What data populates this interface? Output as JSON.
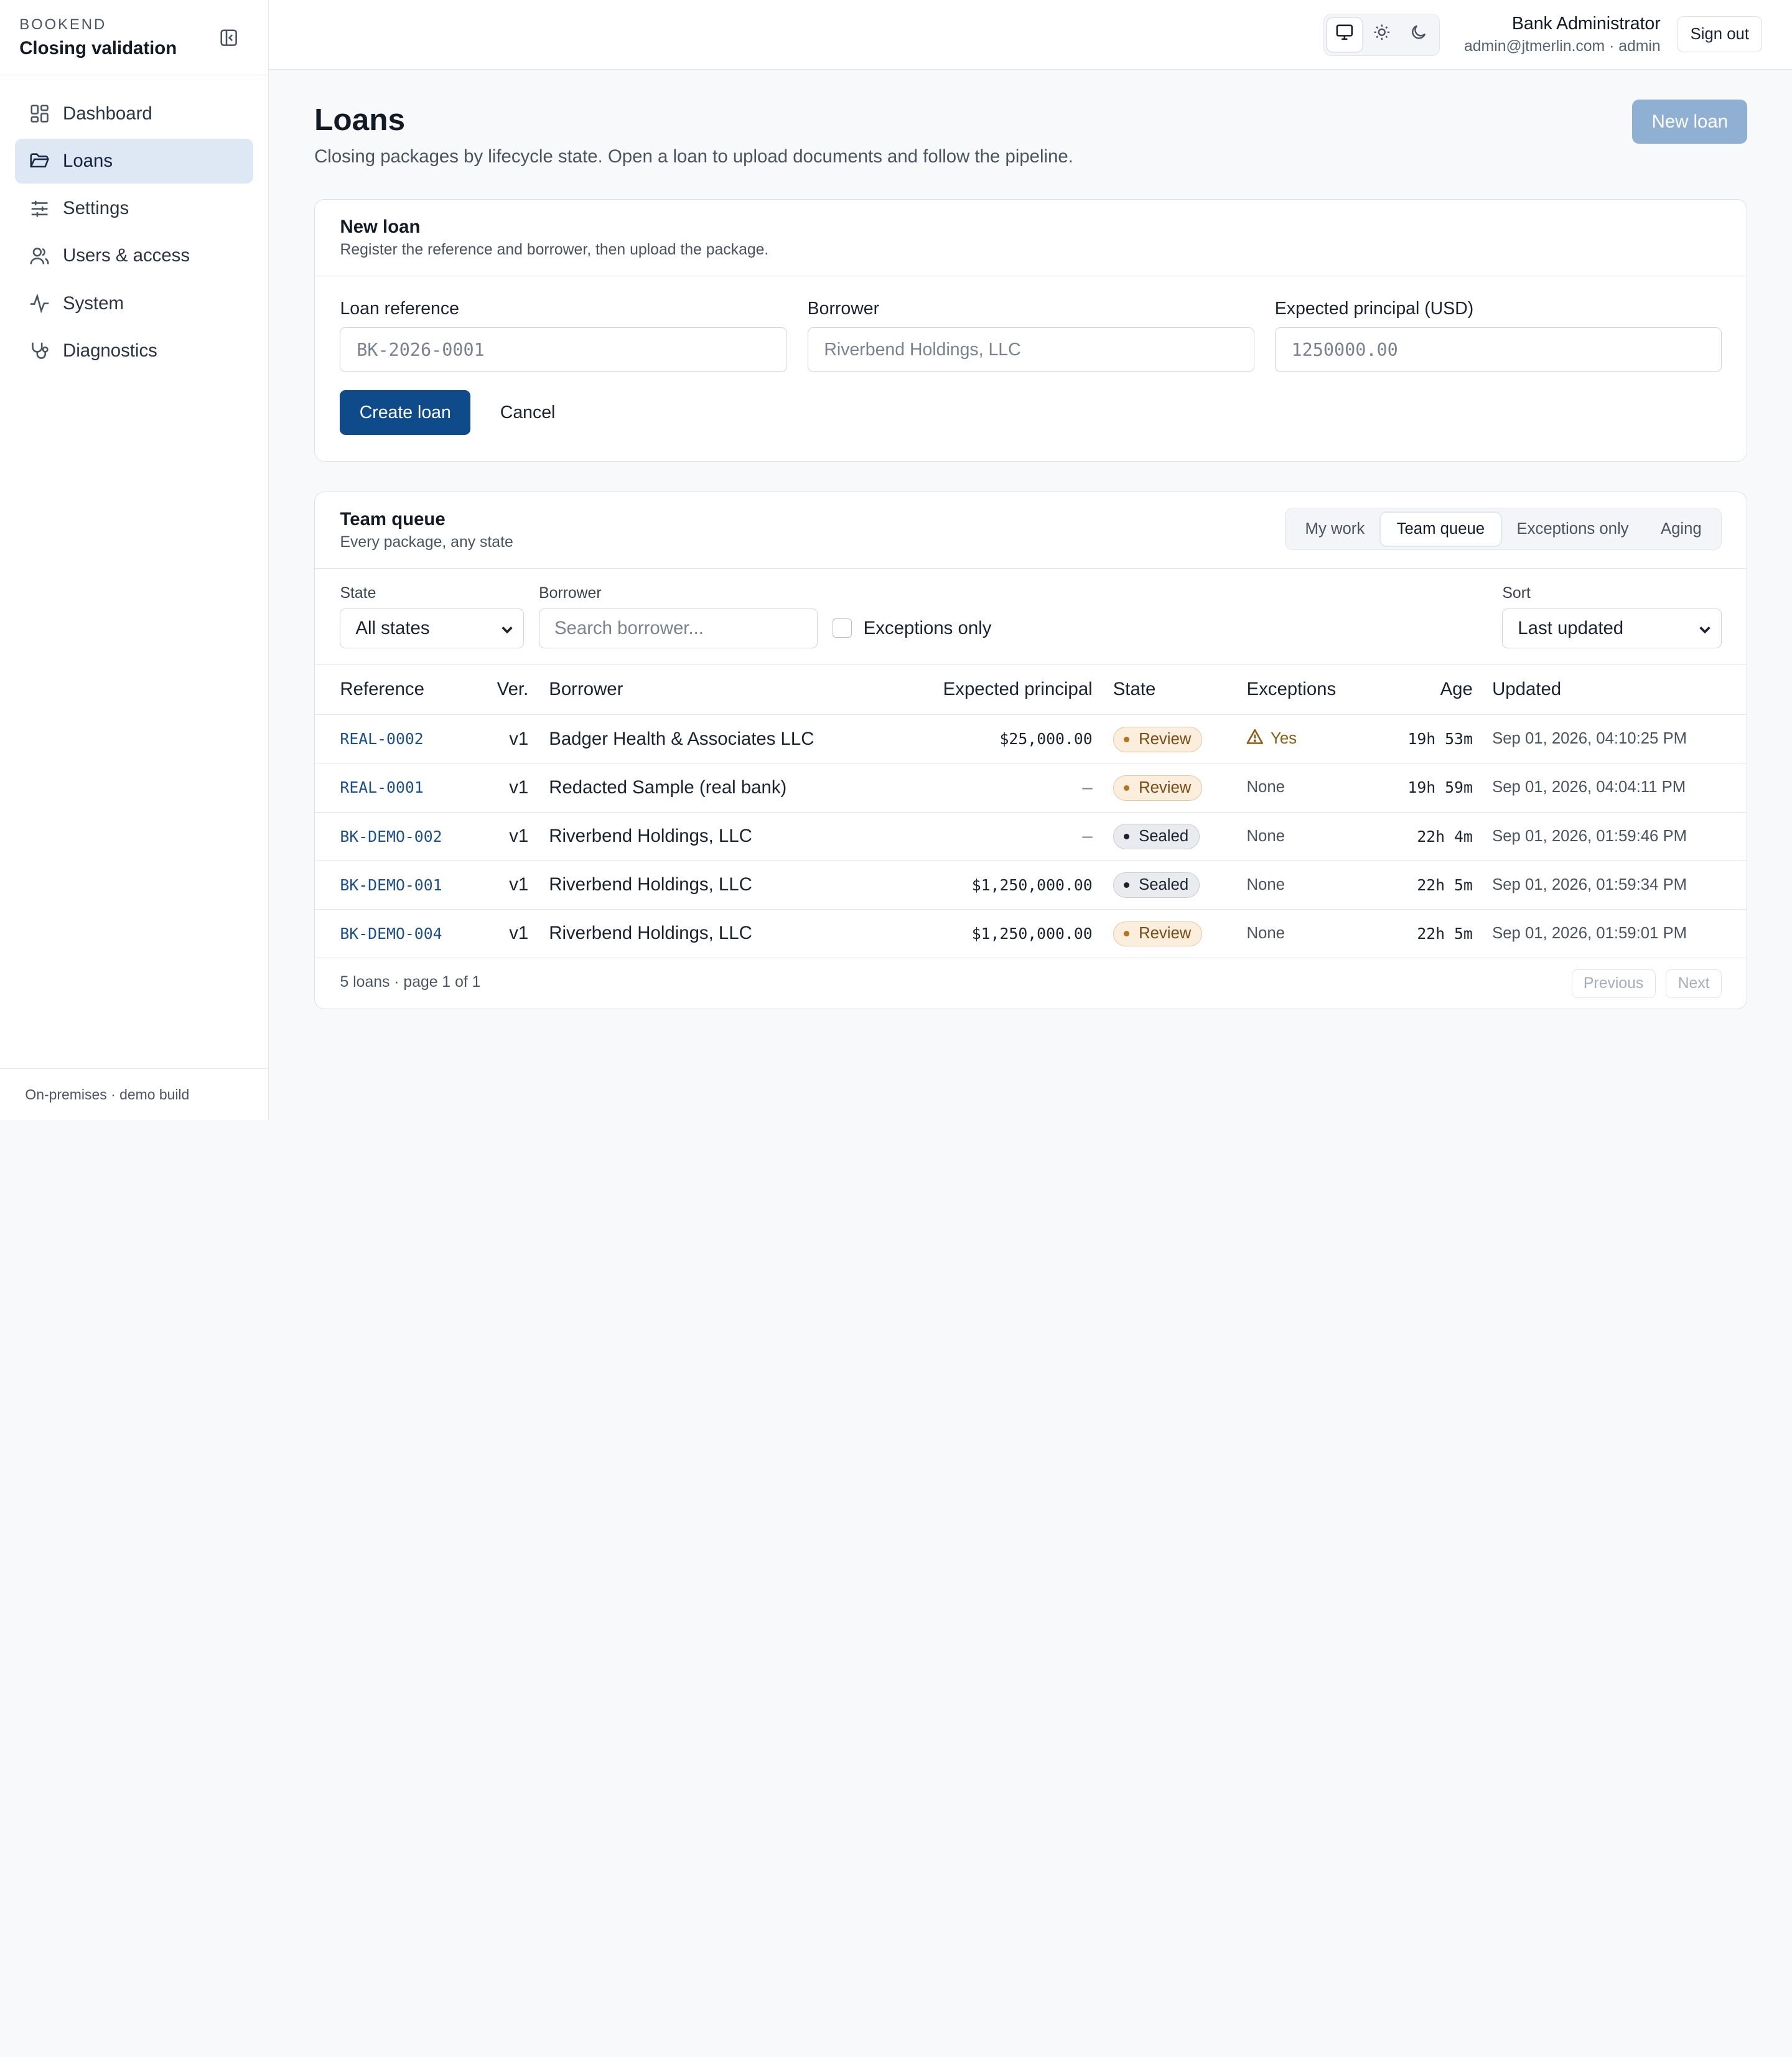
{
  "brand": {
    "eyebrow": "BOOKEND",
    "title": "Closing validation"
  },
  "sidebar": {
    "items": [
      {
        "label": "Dashboard",
        "icon": "dashboard-icon"
      },
      {
        "label": "Loans",
        "icon": "folder-icon",
        "active": true
      },
      {
        "label": "Settings",
        "icon": "sliders-icon"
      },
      {
        "label": "Users & access",
        "icon": "users-icon"
      },
      {
        "label": "System",
        "icon": "activity-icon"
      },
      {
        "label": "Diagnostics",
        "icon": "stethoscope-icon"
      }
    ],
    "footer": "On-premises · demo build"
  },
  "topbar": {
    "theme_options": [
      "monitor-icon",
      "sun-icon",
      "moon-icon"
    ],
    "user_name": "Bank Administrator",
    "user_sub": "admin@jtmerlin.com · admin",
    "signout_label": "Sign out"
  },
  "page": {
    "title": "Loans",
    "subtitle": "Closing packages by lifecycle state. Open a loan to upload documents and follow the pipeline.",
    "new_loan_label": "New loan"
  },
  "new_loan_form": {
    "title": "New loan",
    "subtitle": "Register the reference and borrower, then upload the package.",
    "fields": {
      "reference": {
        "label": "Loan reference",
        "placeholder": "BK-2026-0001"
      },
      "borrower": {
        "label": "Borrower",
        "placeholder": "Riverbend Holdings, LLC"
      },
      "principal": {
        "label": "Expected principal (USD)",
        "placeholder": "1250000.00"
      }
    },
    "create_label": "Create loan",
    "cancel_label": "Cancel"
  },
  "queue": {
    "title": "Team queue",
    "subtitle": "Every package, any state",
    "views": [
      "My work",
      "Team queue",
      "Exceptions only",
      "Aging"
    ],
    "active_view": "Team queue",
    "filters": {
      "state_label": "State",
      "state_value": "All states",
      "borrower_label": "Borrower",
      "borrower_placeholder": "Search borrower...",
      "exceptions_label": "Exceptions only",
      "sort_label": "Sort",
      "sort_value": "Last updated"
    },
    "columns": [
      "Reference",
      "Ver.",
      "Borrower",
      "Expected principal",
      "State",
      "Exceptions",
      "Age",
      "Updated"
    ],
    "rows": [
      {
        "reference": "REAL-0002",
        "version": "v1",
        "borrower": "Badger Health & Associates LLC",
        "principal": "$25,000.00",
        "state": "Review",
        "exceptions": "Yes",
        "age": "19h 53m",
        "updated": "Sep 01, 2026, 04:10:25 PM"
      },
      {
        "reference": "REAL-0001",
        "version": "v1",
        "borrower": "Redacted Sample (real bank)",
        "principal": "–",
        "state": "Review",
        "exceptions": "None",
        "age": "19h 59m",
        "updated": "Sep 01, 2026, 04:04:11 PM"
      },
      {
        "reference": "BK-DEMO-002",
        "version": "v1",
        "borrower": "Riverbend Holdings, LLC",
        "principal": "–",
        "state": "Sealed",
        "exceptions": "None",
        "age": "22h 4m",
        "updated": "Sep 01, 2026, 01:59:46 PM"
      },
      {
        "reference": "BK-DEMO-001",
        "version": "v1",
        "borrower": "Riverbend Holdings, LLC",
        "principal": "$1,250,000.00",
        "state": "Sealed",
        "exceptions": "None",
        "age": "22h 5m",
        "updated": "Sep 01, 2026, 01:59:34 PM"
      },
      {
        "reference": "BK-DEMO-004",
        "version": "v1",
        "borrower": "Riverbend Holdings, LLC",
        "principal": "$1,250,000.00",
        "state": "Review",
        "exceptions": "None",
        "age": "22h 5m",
        "updated": "Sep 01, 2026, 01:59:01 PM"
      }
    ],
    "footer_count": "5 loans · page 1 of 1",
    "previous_label": "Previous",
    "next_label": "Next"
  },
  "colors": {
    "primary": "#0f4a8a",
    "primary_disabled": "#8fb0d2",
    "nav_active_bg": "#dde8f4",
    "review_badge": "#fbeedd",
    "sealed_badge": "#e9ebee"
  }
}
